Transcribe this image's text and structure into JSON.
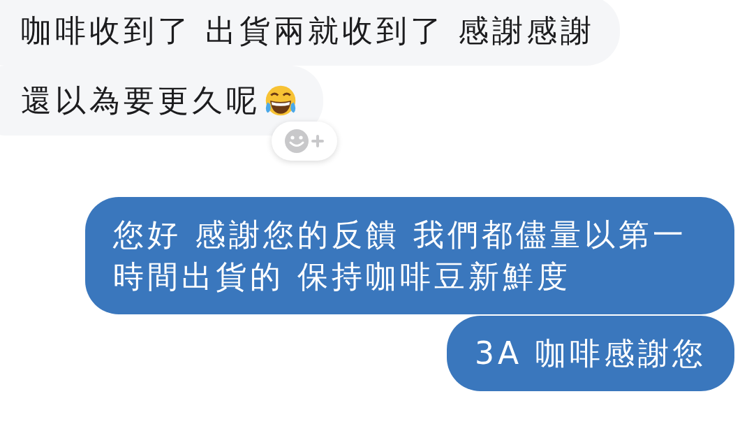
{
  "messages": [
    {
      "kind": "incoming",
      "text": "咖啡收到了 出貨兩就收到了 感謝感謝",
      "emoji": false,
      "reaction_button": false
    },
    {
      "kind": "incoming",
      "text": "還以為要更久呢",
      "emoji": true,
      "reaction_button": true
    },
    {
      "kind": "outgoing",
      "text": "您好 感謝您的反饋 我們都儘量以第一時間出貨的 保持咖啡豆新鮮度",
      "emoji": false,
      "reaction_button": false
    },
    {
      "kind": "outgoing",
      "text": "3A 咖啡感謝您",
      "emoji": false,
      "reaction_button": false
    }
  ]
}
